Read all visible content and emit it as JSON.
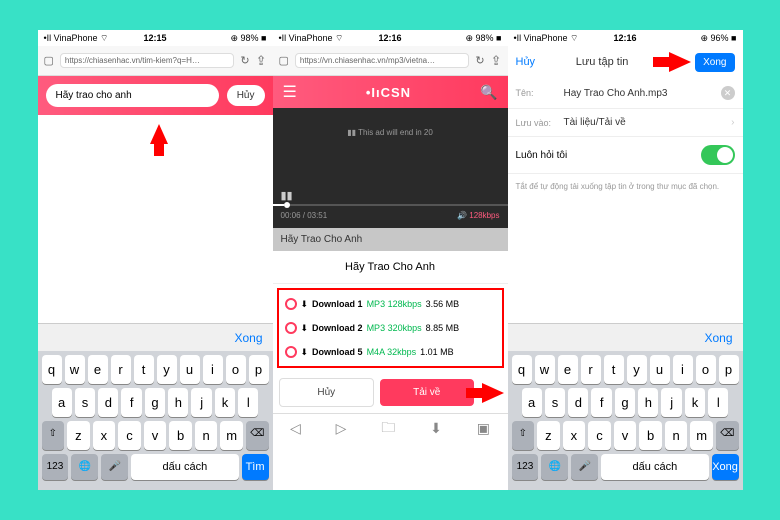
{
  "phone1": {
    "carrier": "•Il VinaPhone ⌔",
    "time": "12:15",
    "battery": "⊕ 98% ■",
    "url": "https://chiasenhac.vn/tim-kiem?q=H…",
    "refresh": "↻",
    "share": "⇪",
    "book": "▢",
    "search_value": "Hãy trao cho anh",
    "cancel": "Hủy",
    "kb_done": "Xong",
    "keys1": [
      "q",
      "w",
      "e",
      "r",
      "t",
      "y",
      "u",
      "i",
      "o",
      "p"
    ],
    "keys2": [
      "a",
      "s",
      "d",
      "f",
      "g",
      "h",
      "j",
      "k",
      "l"
    ],
    "shift": "⇧",
    "keys3": [
      "z",
      "x",
      "c",
      "v",
      "b",
      "n",
      "m"
    ],
    "bksp": "⌫",
    "k123": "123",
    "globe": "🌐",
    "mic": "🎤",
    "space": "dấu cách",
    "enter": "Tìm"
  },
  "phone2": {
    "carrier": "•Il VinaPhone ⌔",
    "time": "12:16",
    "battery": "⊕ 98% ■",
    "url": "https://vn.chiasenhac.vn/mp3/vietna…",
    "logo": "•IıCSN",
    "ad": "This ad will end in 20",
    "pause1": "▮▮",
    "pause2": "▮▮",
    "ptime": "00:06 / 03:51",
    "vol": "🔊 128kbps",
    "title_g": "Hãy Trao Cho Anh",
    "title_w": "Hãy Trao Cho Anh",
    "dl": [
      {
        "n": "Download 1",
        "q": "MP3 128kbps",
        "s": "3.56 MB"
      },
      {
        "n": "Download 2",
        "q": "MP3 320kbps",
        "s": "8.85 MB"
      },
      {
        "n": "Download 5",
        "q": "M4A 32kbps",
        "s": "1.01 MB"
      }
    ],
    "btn_cancel": "Hủy",
    "btn_dl": "Tải về",
    "f_back": "◁",
    "f_fwd": "▷",
    "f_fold": "🗀",
    "f_dl": "⬇",
    "f_tabs": "▣"
  },
  "phone3": {
    "carrier": "•Il VinaPhone ⌔",
    "time": "12:16",
    "battery": "⊕ 96% ■",
    "cancel": "Hủy",
    "title": "Lưu tập tin",
    "done": "Xong",
    "lbl_name": "Tên:",
    "val_name": "Hay Trao Cho Anh.mp3",
    "lbl_save": "Lưu vào:",
    "val_save": "Tài liệu/Tải về",
    "toggle_lbl": "Luôn hỏi tôi",
    "hint": "Tắt để tự động tải xuống tập tin ở trong thư mục đã chọn.",
    "kb_done": "Xong",
    "enter": "Xong"
  }
}
